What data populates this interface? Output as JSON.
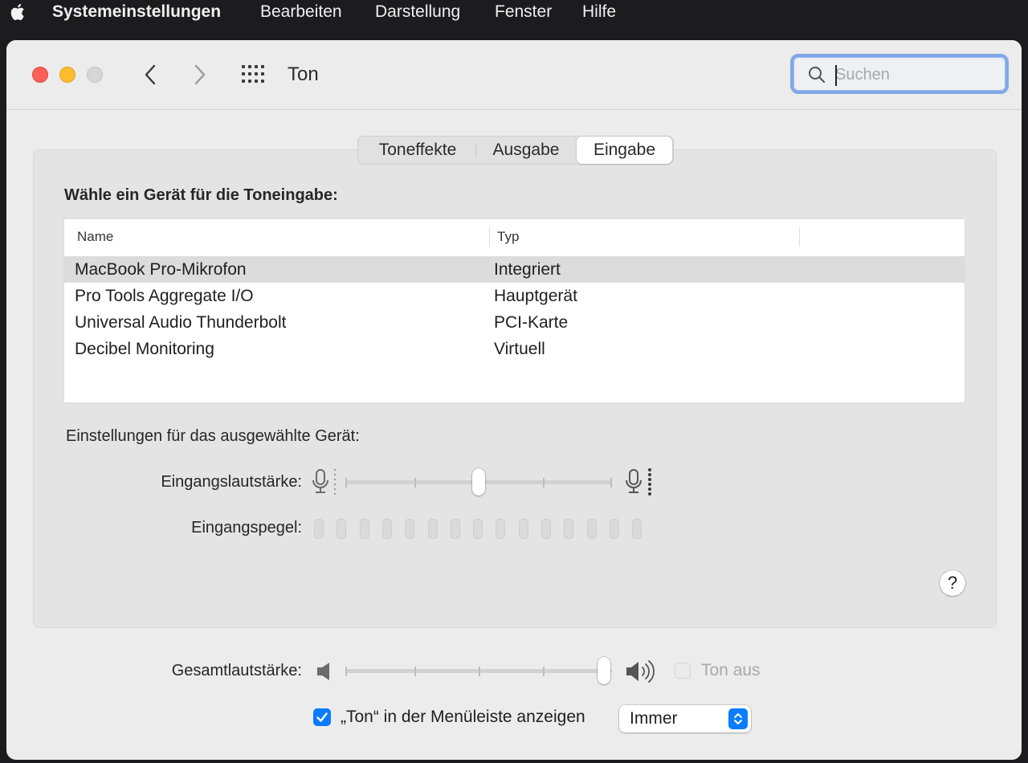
{
  "menubar": {
    "app_name": "Systemeinstellungen",
    "items": [
      "Bearbeiten",
      "Darstellung",
      "Fenster",
      "Hilfe"
    ]
  },
  "window": {
    "title": "Ton",
    "search_placeholder": "Suchen"
  },
  "tabs": [
    {
      "label": "Toneffekte",
      "active": false
    },
    {
      "label": "Ausgabe",
      "active": false
    },
    {
      "label": "Eingabe",
      "active": true
    }
  ],
  "input": {
    "choose_label": "Wähle ein Gerät für die Toneingabe:",
    "columns": [
      "Name",
      "Typ"
    ],
    "devices": [
      {
        "name": "MacBook Pro-Mikrofon",
        "type": "Integriert",
        "selected": true
      },
      {
        "name": "Pro Tools Aggregate I/O",
        "type": "Hauptgerät",
        "selected": false
      },
      {
        "name": "Universal Audio Thunderbolt",
        "type": "PCI-Karte",
        "selected": false
      },
      {
        "name": "Decibel Monitoring",
        "type": "Virtuell",
        "selected": false
      }
    ],
    "settings_label": "Einstellungen für das ausgewählte Gerät:",
    "volume_label": "Eingangslautstärke:",
    "volume_level": 0.5,
    "level_label": "Eingangspegel:",
    "level_segments_lit": 0,
    "level_segments_total": 15,
    "help_label": "?"
  },
  "output": {
    "volume_label": "Gesamtlautstärke:",
    "volume_level": 1.0,
    "mute_label": "Ton aus",
    "mute_checked": false,
    "show_in_menubar_label": "„Ton“ in der Menüleiste anzeigen",
    "show_in_menubar_checked": true,
    "show_in_menubar_value": "Immer"
  },
  "colors": {
    "accent": "#0a7cff",
    "close": "#fe5f57",
    "minimize": "#febc2e",
    "zoom_inactive": "#d6d6d6"
  }
}
